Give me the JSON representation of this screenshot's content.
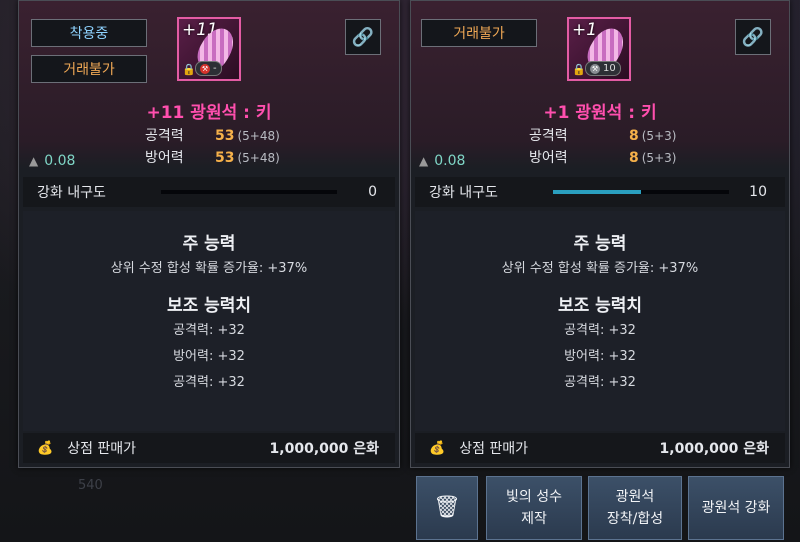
{
  "background_ghost": {
    "number": "540"
  },
  "left_card": {
    "tags": {
      "equipped": "착용중",
      "no_trade": "거래불가"
    },
    "icon": {
      "enhance_level": "+11",
      "badge_value": "-"
    },
    "name": "+11 광원석 : 키",
    "stats": [
      {
        "label": "공격력",
        "value": "53",
        "detail": "(5+48)"
      },
      {
        "label": "방어력",
        "value": "53",
        "detail": "(5+48)"
      }
    ],
    "weight": "0.08",
    "durability": {
      "label": "강화 내구도",
      "value": "0",
      "fraction": 0
    },
    "main_ability": {
      "title": "주 능력",
      "line": "상위 수정 합성 확률 증가율: +37%"
    },
    "sub_ability": {
      "title": "보조 능력치",
      "lines": [
        "공격력: +32",
        "방어력: +32",
        "공격력: +32"
      ]
    },
    "price": {
      "label": "상점 판매가",
      "amount": "1,000,000 은화"
    }
  },
  "right_card": {
    "tags": {
      "no_trade": "거래불가"
    },
    "icon": {
      "enhance_level": "+1",
      "badge_value": "10"
    },
    "name": "+1 광원석 : 키",
    "stats": [
      {
        "label": "공격력",
        "value": "8",
        "detail": "(5+3)"
      },
      {
        "label": "방어력",
        "value": "8",
        "detail": "(5+3)"
      }
    ],
    "weight": "0.08",
    "durability": {
      "label": "강화 내구도",
      "value": "10",
      "fraction": 0.5
    },
    "main_ability": {
      "title": "주 능력",
      "line": "상위 수정 합성 확률 증가율: +37%"
    },
    "sub_ability": {
      "title": "보조 능력치",
      "lines": [
        "공격력: +32",
        "방어력: +32",
        "공격력: +32"
      ]
    },
    "price": {
      "label": "상점 판매가",
      "amount": "1,000,000 은화"
    }
  },
  "actions": {
    "delete_icon": "trash-icon",
    "craft_line1": "빛의 성수",
    "craft_line2": "제작",
    "equip_line1": "광원석",
    "equip_line2": "장착/합성",
    "enhance": "광원석 강화"
  },
  "colors": {
    "item_name": "#ff4fae",
    "stat_value": "#f5b14a",
    "weight": "#7fd6c6",
    "durability_fill": "#2a9fbf",
    "icon_border": "#e35ca4"
  }
}
